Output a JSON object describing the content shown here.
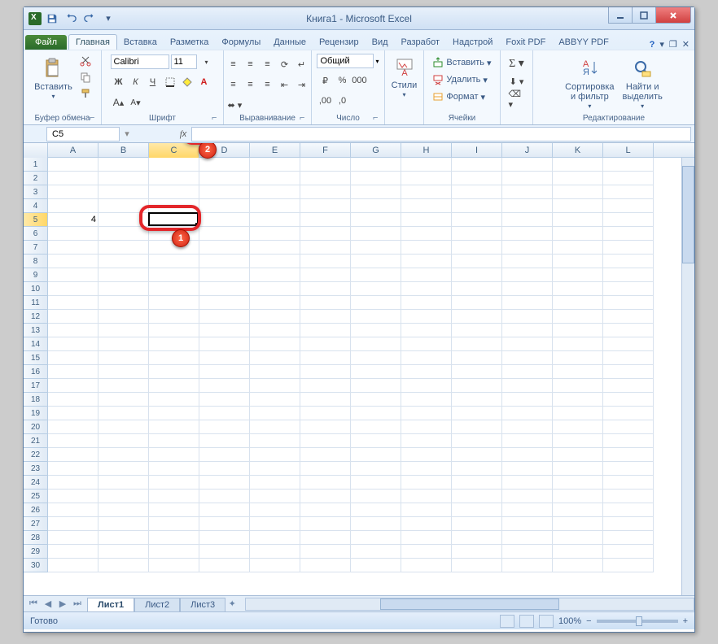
{
  "title": "Книга1 - Microsoft Excel",
  "file_tab": "Файл",
  "tabs": [
    "Главная",
    "Вставка",
    "Разметка",
    "Формулы",
    "Данные",
    "Рецензир",
    "Вид",
    "Разработ",
    "Надстрой",
    "Foxit PDF",
    "ABBYY PDF"
  ],
  "active_tab": 0,
  "groups": {
    "clipboard": {
      "label": "Буфер обмена",
      "paste": "Вставить"
    },
    "font": {
      "label": "Шрифт",
      "name": "Calibri",
      "size": "11"
    },
    "align": {
      "label": "Выравнивание"
    },
    "number": {
      "label": "Число",
      "format": "Общий"
    },
    "styles": {
      "label": "",
      "btn": "Стили"
    },
    "cells": {
      "label": "Ячейки",
      "insert": "Вставить",
      "delete": "Удалить",
      "format": "Формат"
    },
    "editing": {
      "label": "Редактирование",
      "sort": "Сортировка\nи фильтр",
      "find": "Найти и\nвыделить"
    }
  },
  "name_box": "C5",
  "formula": "",
  "columns": [
    "A",
    "B",
    "C",
    "D",
    "E",
    "F",
    "G",
    "H",
    "I",
    "J",
    "K",
    "L"
  ],
  "row_count": 30,
  "cells": {
    "A5": "4"
  },
  "selected": {
    "col": "C",
    "row": 5
  },
  "sheets": [
    "Лист1",
    "Лист2",
    "Лист3"
  ],
  "active_sheet": 0,
  "status": "Готово",
  "zoom": "100%",
  "annotations": [
    {
      "id": "1",
      "target": "cell-C5"
    },
    {
      "id": "2",
      "target": "fx-button"
    }
  ]
}
